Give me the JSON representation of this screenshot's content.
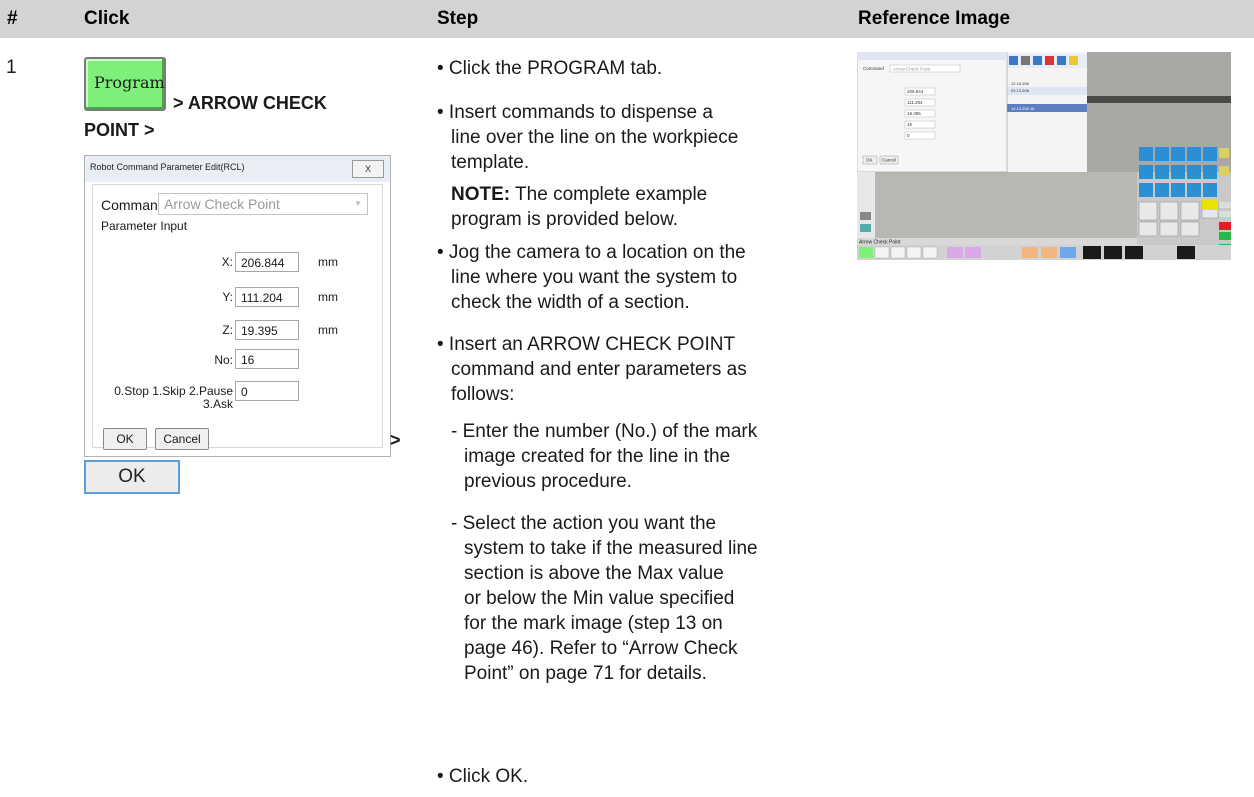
{
  "header": {
    "num": "#",
    "click": "Click",
    "step": "Step",
    "ref": "Reference Image"
  },
  "row": {
    "number": "1",
    "program_button": "Program",
    "click_path_1": "> ARROW CHECK",
    "click_path_2": "POINT >",
    "after_dialog": ">",
    "ok_button": "OK"
  },
  "dialog": {
    "title": "Robot Command Parameter Edit(RCL)",
    "close": "X",
    "command_label": "Command",
    "command_value": "Arrow Check Point",
    "param_label": "Parameter Input",
    "fields": [
      {
        "label": "X:",
        "value": "206.844",
        "unit": "mm"
      },
      {
        "label": "Y:",
        "value": "111.204",
        "unit": "mm"
      },
      {
        "label": "Z:",
        "value": "19.395",
        "unit": "mm"
      },
      {
        "label": "No:",
        "value": "16",
        "unit": ""
      }
    ],
    "stop_label_1": "0.Stop 1.Skip 2.Pause",
    "stop_label_2": "3.Ask",
    "stop_value": "0",
    "ok": "OK",
    "cancel": "Cancel"
  },
  "steps": {
    "s1": "• Click the PROGRAM tab.",
    "s2_lines": [
      "• Insert commands to dispense a",
      "line over the line on the workpiece",
      "template."
    ],
    "note_bold": "NOTE:",
    "note_rest": " The complete example",
    "note_line2": "program is provided below.",
    "s3_lines": [
      "• Jog the camera to a location on the",
      "line where you want the system to",
      "check the width of a section."
    ],
    "s4_lines": [
      "• Insert an ARROW CHECK POINT",
      "command and enter parameters as",
      "follows:"
    ],
    "sub1_lines": [
      "- Enter the number (No.) of the mark",
      "image created for the line in the",
      "previous procedure."
    ],
    "sub2_lines": [
      "- Select the action you want the",
      "system to take if the measured line",
      "section is above the Max value",
      "or below the Min value specified",
      "for the mark image (step 13 on",
      "page 46). Refer to “Arrow Check",
      "Point” on page 71 for details."
    ],
    "s5": "• Click OK."
  },
  "reference": {
    "status_text": "Arrow Check Point",
    "command_value": "Arrow Check Point",
    "x": "206.844",
    "y": "111.204",
    "z": "19.395",
    "no": "16",
    "stop": "0",
    "ok": "OK",
    "cancel": "Cancel",
    "table_vals": [
      "12  18.396",
      "03  13.206",
      "14  13.206  16"
    ],
    "col_heads": [
      "2",
      "3",
      "4",
      "5",
      "6"
    ]
  },
  "colors": {
    "header_bg": "#d3d3d3",
    "program_green": "#7ef07a",
    "ok_border": "#5aa0dc"
  }
}
